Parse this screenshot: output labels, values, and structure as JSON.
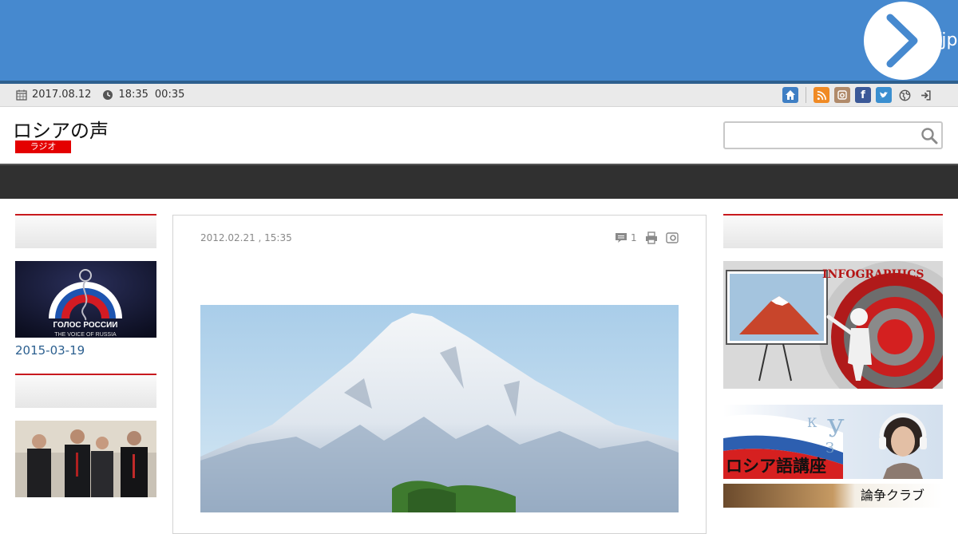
{
  "banner": {
    "url_text": "http://jp",
    "colors": {
      "background": "#4689cf"
    }
  },
  "infobar": {
    "date": "2017.08.12",
    "time_1": "18:35",
    "time_2": "00:35",
    "icons": [
      "home-icon",
      "rss-icon",
      "instagram-icon",
      "facebook-icon",
      "twitter-icon",
      "globe-icon",
      "login-icon"
    ]
  },
  "header": {
    "site_title": "ロシアの声",
    "site_tag": "ラジオ",
    "search": {
      "placeholder": ""
    }
  },
  "left_column": {
    "items": [
      {
        "image_caption_line1": "ГОЛОС РОССИИ",
        "image_caption_line2": "THE VOICE OF RUSSIA",
        "date": "2015-03-19"
      }
    ]
  },
  "article": {
    "meta": "2012.02.21 , 15:35",
    "comment_count": "1",
    "photo": "mount-fuji-photo"
  },
  "right_column": {
    "promo_infographics": "INFOGRAPHICS",
    "promo_language": "ロシア語講座",
    "promo_club": "論争クラブ"
  },
  "colors": {
    "accent_red": "#c8191e",
    "tag_red": "#e40000",
    "nav_dark": "#303030",
    "link_blue": "#2b5f8f"
  }
}
